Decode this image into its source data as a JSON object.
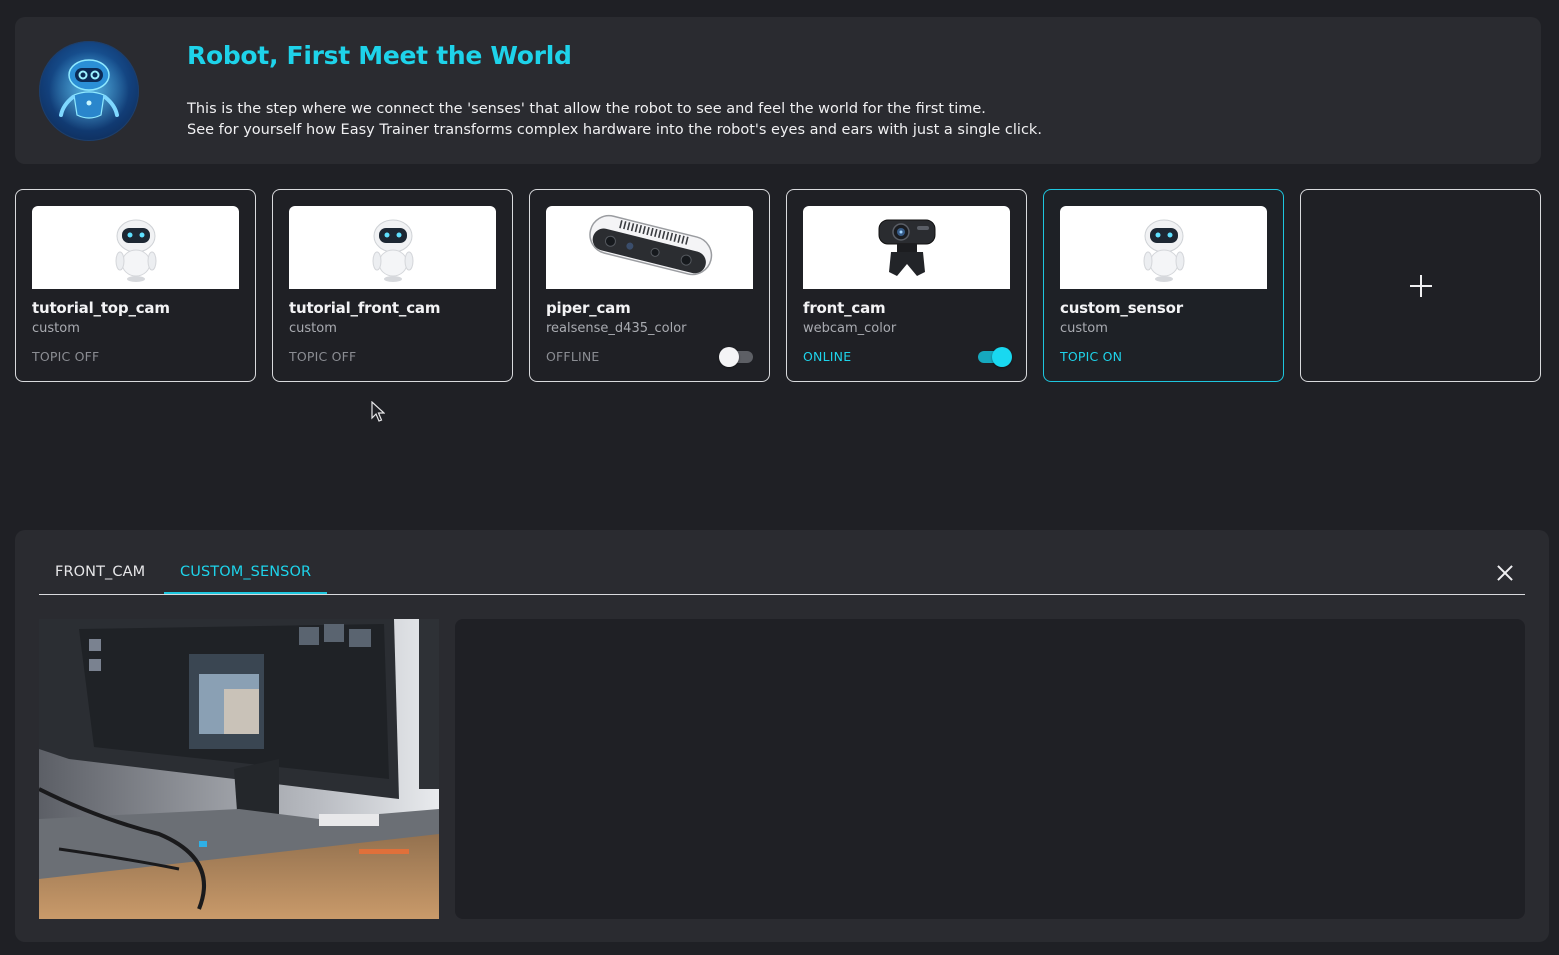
{
  "header": {
    "title": "Robot, First Meet the World",
    "description_line1": "This is the step where we connect the 'senses' that allow the robot to see and feel the world for the first time.",
    "description_line2": "See for yourself how Easy Trainer transforms complex hardware into the robot's eyes and ears with just a single click."
  },
  "sensors": [
    {
      "name": "tutorial_top_cam",
      "type": "custom",
      "status": "TOPIC OFF",
      "icon": "robot-icon"
    },
    {
      "name": "tutorial_front_cam",
      "type": "custom",
      "status": "TOPIC OFF",
      "icon": "robot-icon"
    },
    {
      "name": "piper_cam",
      "type": "realsense_d435_color",
      "status": "OFFLINE",
      "icon": "realsense-camera-icon",
      "toggle": false
    },
    {
      "name": "front_cam",
      "type": "webcam_color",
      "status": "ONLINE",
      "icon": "webcam-icon",
      "toggle": true
    },
    {
      "name": "custom_sensor",
      "type": "custom",
      "status": "TOPIC ON",
      "icon": "robot-icon",
      "selected": true
    }
  ],
  "add_sensor": {
    "icon": "plus-icon"
  },
  "viewer": {
    "tabs": [
      {
        "label": "FRONT_CAM",
        "active": false
      },
      {
        "label": "CUSTOM_SENSOR",
        "active": true
      }
    ],
    "close_icon": "close-icon"
  },
  "colors": {
    "accent": "#1ed3ea",
    "background": "#1f2025",
    "panel": "#2a2b30"
  }
}
